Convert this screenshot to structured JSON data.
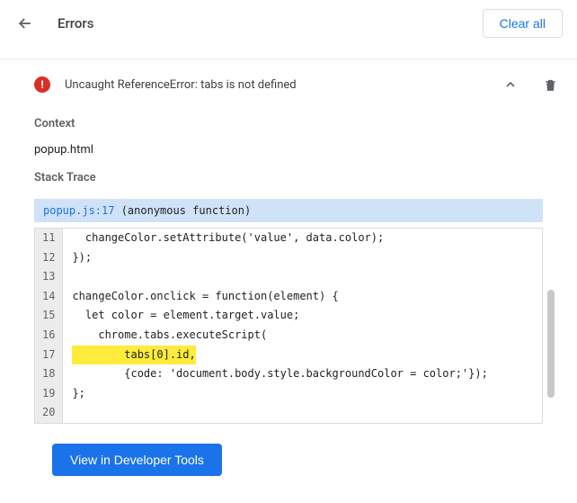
{
  "header": {
    "title": "Errors",
    "clear_all": "Clear all"
  },
  "error": {
    "message": "Uncaught ReferenceError: tabs is not defined",
    "context_label": "Context",
    "context_value": "popup.html",
    "stack_trace_label": "Stack Trace",
    "stack_file": "popup.js:17",
    "stack_fn": " (anonymous function)"
  },
  "code": {
    "lines": [
      {
        "n": 11,
        "text": "  changeColor.setAttribute('value', data.color);"
      },
      {
        "n": 12,
        "text": "});"
      },
      {
        "n": 13,
        "text": ""
      },
      {
        "n": 14,
        "text": "changeColor.onclick = function(element) {"
      },
      {
        "n": 15,
        "text": "  let color = element.target.value;"
      },
      {
        "n": 16,
        "text": "    chrome.tabs.executeScript("
      },
      {
        "n": 17,
        "text": "        tabs[0].id,",
        "hl": true
      },
      {
        "n": 18,
        "text": "        {code: 'document.body.style.backgroundColor = color;'});"
      },
      {
        "n": 19,
        "text": "};"
      },
      {
        "n": 20,
        "text": ""
      }
    ]
  },
  "buttons": {
    "view_devtools": "View in Developer Tools"
  }
}
